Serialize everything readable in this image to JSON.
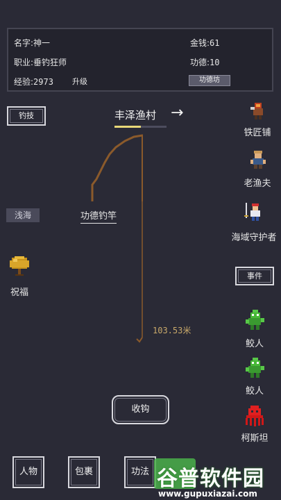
{
  "stats": {
    "name_label": "名字:",
    "name_value": "神一",
    "money_label": "金钱:",
    "money_value": "61",
    "job_label": "职业:",
    "job_value": "垂钓狂师",
    "merit_label": "功德:",
    "merit_value": "10",
    "exp_label": "经验:",
    "exp_value": "2973",
    "upgrade_label": "升级",
    "merit_shop_label": "功德坊"
  },
  "left": {
    "skill_button": "钓技",
    "zone_tag": "浅海",
    "blessing_label": "祝福"
  },
  "location": {
    "name": "丰泽渔村",
    "arrow": "→",
    "progress": 0.5
  },
  "rod": {
    "name": "功德钓竿",
    "depth": "103.53米"
  },
  "right_npcs": [
    {
      "label": "铁匠铺"
    },
    {
      "label": "老渔夫"
    },
    {
      "label": "海域守护者"
    }
  ],
  "event_button": "事件",
  "encounters": [
    {
      "label": "鲛人"
    },
    {
      "label": "鲛人"
    },
    {
      "label": "柯斯坦"
    }
  ],
  "reel_button": "收钩",
  "bottom_nav": {
    "character": "人物",
    "bag": "包裹",
    "skills": "功法"
  },
  "watermark": {
    "title": "谷普软件园",
    "url": "www.gupuxiazai.com"
  }
}
